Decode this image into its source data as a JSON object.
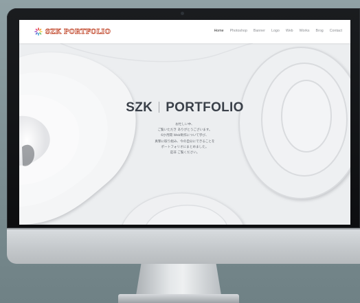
{
  "site": {
    "logo_text": "SZK PORTFOLIO",
    "nav": [
      "Home",
      "Photoshop",
      "Banner",
      "Logo",
      "Web",
      "Works",
      "Brog",
      "Contact"
    ],
    "active_nav": "Home"
  },
  "hero": {
    "title_left": "SZK",
    "title_right": "PORTFOLIO",
    "intro_lines": [
      "お忙しい中、",
      "ご覧いただき ありがとうございます。",
      "6か月間 Web制作について学び、",
      "真摯に取り組み、今の自分にできることを",
      "ポートフォリオにまとめました。",
      "是非 ご覧ください。"
    ]
  },
  "colors": {
    "logo_accent": "#c24a2e",
    "text_dark": "#3a4049",
    "nav_muted": "#8a8d91"
  }
}
